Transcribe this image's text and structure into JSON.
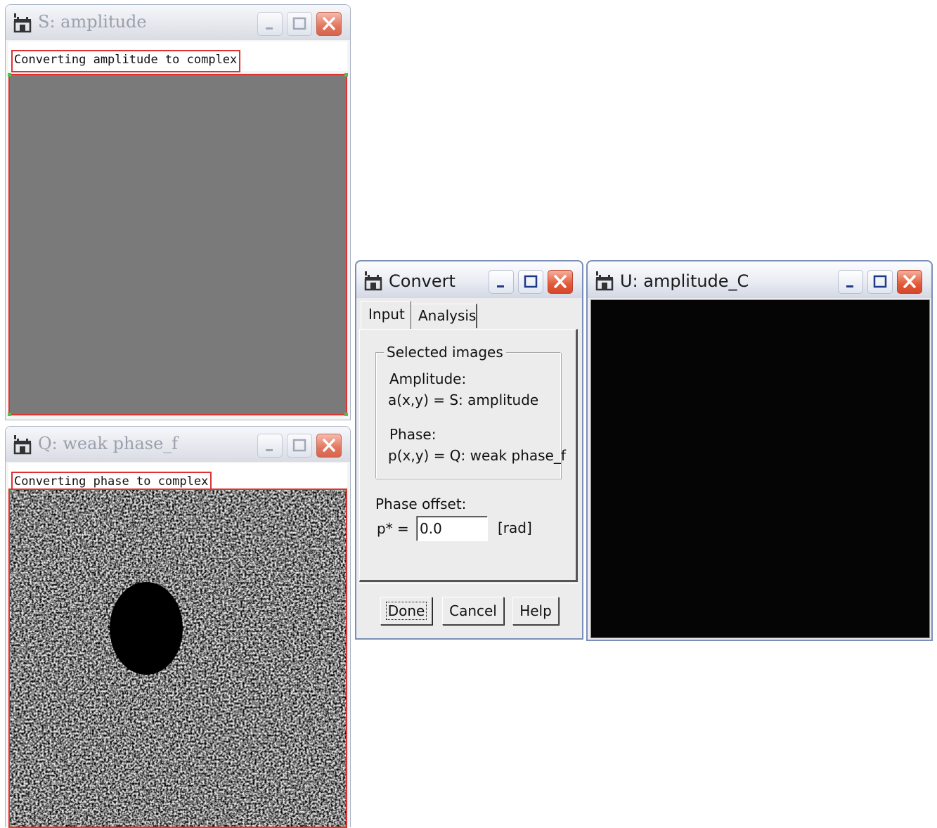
{
  "windows": {
    "amplitude": {
      "title": "S: amplitude",
      "caption": "Converting amplitude to complex",
      "image_color": "#7a7a7a"
    },
    "phase": {
      "title": "Q: weak phase_f",
      "caption": "Converting phase to complex",
      "image_description_color": "#c8c8c8"
    },
    "output": {
      "title": "U: amplitude_C",
      "image_color": "#050505"
    }
  },
  "convert_dialog": {
    "title": "Convert",
    "tabs": [
      {
        "label": "Input",
        "selected": true
      },
      {
        "label": "Analysis",
        "selected": false
      }
    ],
    "selected_images": {
      "group_label": "Selected images",
      "amplitude_label": "Amplitude:",
      "amplitude_value": "a(x,y) = S: amplitude",
      "phase_label": "Phase:",
      "phase_value": "p(x,y) = Q: weak phase_f"
    },
    "phase_offset": {
      "label": "Phase offset:",
      "symbol": "p* =",
      "value": "0.0",
      "unit": "[rad]"
    },
    "buttons": {
      "done": "Done",
      "cancel": "Cancel",
      "help": "Help"
    }
  },
  "colors": {
    "caption_border": "#e03030",
    "close_button": "#e25a39",
    "corner_markers": "#4cc44c"
  },
  "icons": {
    "app": "castle-app-icon",
    "minimize": "minimize-icon",
    "maximize": "maximize-icon",
    "close": "close-icon"
  }
}
